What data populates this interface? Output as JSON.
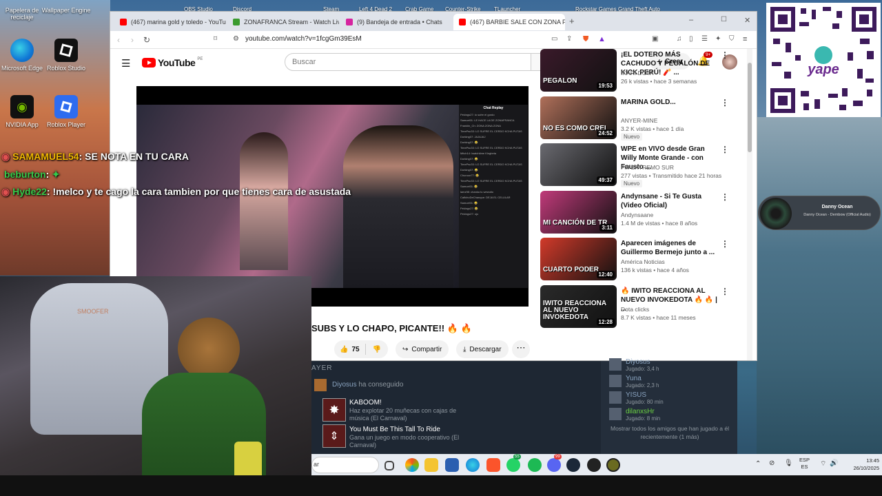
{
  "desktop": {
    "icons": [
      {
        "label": "Papelera de reciclaje",
        "icon": "recycle-bin-icon"
      },
      {
        "label": "Wallpaper Engine",
        "icon": "wallpaper-engine-icon"
      },
      {
        "label": "Microsoft Edge",
        "icon": "edge-icon"
      },
      {
        "label": "Roblox Studio",
        "icon": "roblox-studio-icon"
      },
      {
        "label": "NVIDIA App",
        "icon": "nvidia-icon"
      },
      {
        "label": "Roblox Player",
        "icon": "roblox-player-icon"
      }
    ],
    "top_icons": [
      "OBS Studio",
      "Discord",
      "Steam",
      "Left 4 Dead 2",
      "Crab Game",
      "Counter-Strike",
      "TLauncher",
      "Rockstar Games",
      "Grand Theft Auto"
    ]
  },
  "qr": {
    "brand": "yape"
  },
  "music_widget": {
    "title": "Danny Ocean",
    "subtitle": "Danny Ocean - Dembow (Official Audio)"
  },
  "overlay_chat": [
    {
      "user": "SAMAMUEL54",
      "sep": ":",
      "text": "SE NOTA EN TU CARA",
      "color": "#f0b800"
    },
    {
      "user": "beburton",
      "sep": ":",
      "text": "",
      "color": "#36c94a"
    },
    {
      "user": "Hyde22",
      "sep": ":",
      "text": "!melco y te cago la cara tambien por que tienes cara de asustada",
      "color": "#36c94a"
    }
  ],
  "browser": {
    "tabs": [
      {
        "title": "(467) marina gold y toledo - YouTube",
        "color": "#f00"
      },
      {
        "title": "ZONAFRANCA Stream - Watch Live o",
        "color": "#3a9b2e"
      },
      {
        "title": "(9) Bandeja de entrada • Chats",
        "color": "#d6249f"
      },
      {
        "title": "(467) BARBIE SALE CON ZONA F",
        "color": "#f00",
        "active": true
      }
    ],
    "new_tab": "+",
    "window_controls": [
      "–",
      "☐",
      "✕"
    ],
    "url": "youtube.com/watch?v=1fcgGm39EsM"
  },
  "youtube": {
    "logo": "YouTube",
    "region": "PE",
    "search_placeholder": "Buscar",
    "create_label": "Crear",
    "notif_badge": "9+",
    "video_title": "SUBS Y LO CHAPO, PICANTE!! 🔥 🔥",
    "likes": "75",
    "share_label": "Compartir",
    "download_label": "Descargar",
    "chat_replay_title": "Chat Replay",
    "chat_lines": [
      "Pekings27: lo sufre el gordo",
      "Samuel01: LE HACE LA DE ZONAFRANCA",
      "Franklin_Ch: ZONA ZONA ZONA",
      "TimePsc33: LO SUFRE EL CERDO KCHA PUTAS",
      "Dorking07: JAJAJAJ",
      "Dorking07: 😂",
      "TimePsc33: LO SUFRE EL CERDO KCHA PUTAS",
      "Mitch14: lwatchtime Kingbeta",
      "Dorking07: 😂",
      "TimePsc33: LO SUFRE EL CERDO KCHA PUTAS",
      "Dorking07: 😂",
      "Chunoor77: 😂",
      "TimePsc33: LO SUFRE EL CERDO KCHA PUTAS",
      "Samuel01: 😂",
      "lamz98: chanka tu wewutio",
      "CalfchoDeChanque: DEJA EL CELULAR",
      "Samuel01: 😂",
      "Pekings27: 😂",
      "Pekings27: ojo"
    ],
    "recommendations": [
      {
        "title": "¡EL DOTERO MÁS CACHUDO Y PEGALÓN DE KICK PERÚ! 🧨 ...",
        "channel": "IKARI DOTA",
        "meta": "26 k vistas • hace 3 semanas",
        "duration": "19:53",
        "badge": "",
        "thumb_text": "PEGALON",
        "thumb_color": "#3a1a2a"
      },
      {
        "title": "MARINA GOLD...",
        "channel": "ANYER-MINE",
        "meta": "3.2 K vistas • hace 1 día",
        "duration": "24:52",
        "badge": "Nuevo",
        "thumb_text": "NO ES COMO CREI",
        "thumb_color": "#b0705a"
      },
      {
        "title": "WPE en VIVO desde Gran Willy Monte Grande - con Fausto ...",
        "channel": "FM EXTREMO SUR",
        "meta": "277 vistas • Transmitido hace 21 horas",
        "duration": "49:37",
        "badge": "Nuevo",
        "thumb_text": "",
        "thumb_color": "#6a6a70"
      },
      {
        "title": "Andynsane - Si Te Gusta (Video Oficial)",
        "channel": "Andynsaane",
        "meta": "1.4 M de vistas • hace 8 años",
        "duration": "3:11",
        "badge": "",
        "thumb_text": "MI CANCIÓN DE TR",
        "thumb_color": "#c03a7a"
      },
      {
        "title": "Aparecen imágenes de Guillermo Bermejo junto a ...",
        "channel": "América Noticias",
        "meta": "136 k vistas • hace 4 años",
        "duration": "12:40",
        "badge": "",
        "thumb_text": "CUARTO PODER",
        "thumb_color": "#d23a2a"
      },
      {
        "title": "🔥 IWITO REACCIONA AL NUEVO INVOKEDOTA 🔥 🔥 | ...",
        "channel": "Dota clicks",
        "meta": "8.7 K vistas • hace 11 meses",
        "duration": "12:28",
        "badge": "",
        "thumb_text": "IWITO REACCIONA AL NUEVO INVOKEDOTA",
        "thumb_color": "#2a2a2a"
      }
    ]
  },
  "steam": {
    "section": "AYER",
    "activity_user": "Diyosus",
    "activity_verb": "ha conseguido",
    "achievements": [
      {
        "name": "KABOOM!",
        "desc": "Haz explotar 20 muñecas con cajas de música (El Carnaval)"
      },
      {
        "name": "You Must Be This Tall To Ride",
        "desc": "Gana un juego en modo cooperativo (El Carnaval)"
      }
    ],
    "friends": [
      {
        "name": "Diyosus",
        "played": "Jugado: 3,4 h",
        "color": "#8aa4c0"
      },
      {
        "name": "Yuna",
        "played": "Jugado: 2,3 h",
        "color": "#8aa4c0"
      },
      {
        "name": "YISUS",
        "played": "Jugado: 80 min",
        "color": "#8aa4c0"
      },
      {
        "name": "dilanxsHr",
        "played": "Jugado: 8 min",
        "color": "#6bd142"
      }
    ],
    "show_all": "Mostrar todos los amigos que han jugado a él recientemente (1 más)"
  },
  "taskbar": {
    "search_placeholder": "ar",
    "whatsapp_badge": "55",
    "discord_badge": "99",
    "lang_top": "ESP",
    "lang_bottom": "ES",
    "time": "13:45",
    "date": "26/10/2025"
  },
  "webcam": {
    "caption": "SMOOFER"
  }
}
